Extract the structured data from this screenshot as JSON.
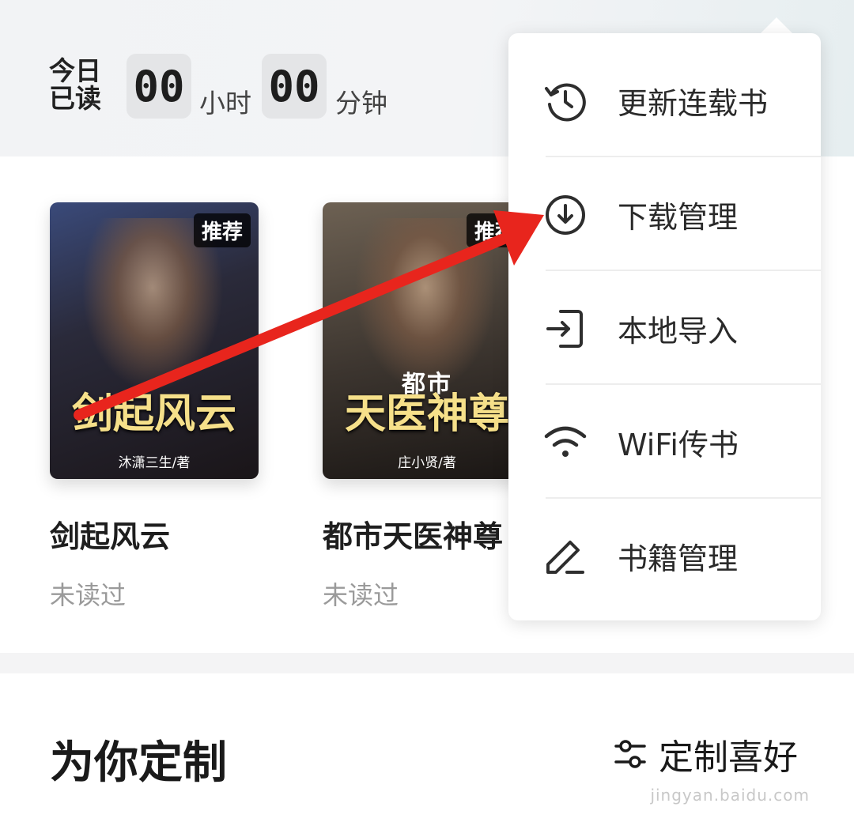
{
  "reading_stats": {
    "label": "今日已读",
    "hours": "00",
    "hours_unit": "小时",
    "minutes": "00",
    "minutes_unit": "分钟"
  },
  "books": [
    {
      "title": "剑起风云",
      "status": "未读过",
      "badge": "推荐",
      "cover_title": "剑起风云",
      "cover_author": "沐潇三生/著"
    },
    {
      "title": "都市天医神尊",
      "status": "未读过",
      "badge": "推荐",
      "cover_tag": "都市",
      "cover_title": "天医神尊",
      "cover_author": "庄小贤/著"
    }
  ],
  "menu": {
    "items": [
      {
        "label": "更新连载书",
        "icon": "history-clock-icon"
      },
      {
        "label": "下载管理",
        "icon": "download-icon"
      },
      {
        "label": "本地导入",
        "icon": "import-icon"
      },
      {
        "label": "WiFi传书",
        "icon": "wifi-icon"
      },
      {
        "label": "书籍管理",
        "icon": "edit-pencil-icon"
      }
    ]
  },
  "section": {
    "title": "为你定制",
    "preference_label": "定制喜好",
    "preference_icon": "sliders-icon"
  },
  "watermark": "jingyan.baidu.com",
  "colors": {
    "annotation_arrow": "#e8251d",
    "text_primary": "#1e1e1e",
    "text_muted": "#9a9a9a"
  }
}
